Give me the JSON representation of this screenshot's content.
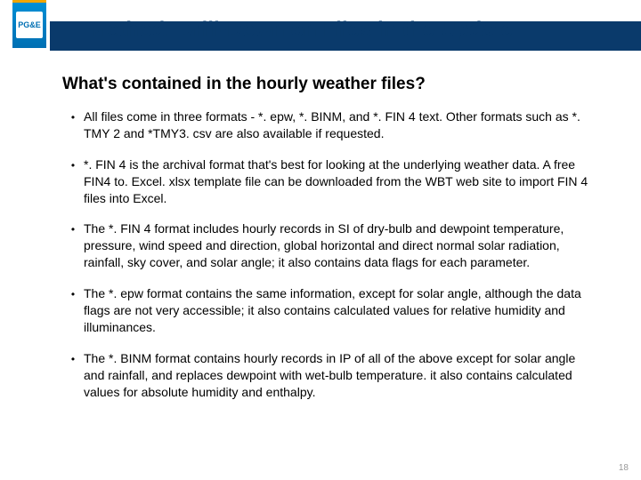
{
  "logo_text": "PG&E",
  "title": "Method: Drill-Down on Files in the Update",
  "subtitle": "What's contained in the hourly weather files?",
  "bullets": [
    "All files come in three formats - *. epw,  *. BINM, and *. FIN 4 text.  Other formats such as *. TMY 2 and *TMY3. csv are also available if requested.",
    "*. FIN 4 is the archival format that's best for looking at the underlying weather data. A free FIN4 to. Excel. xlsx template file can be downloaded from the WBT web site to import FIN 4 files into Excel.",
    "The *. FIN 4 format includes hourly records in SI of dry-bulb and dewpoint temperature, pressure, wind speed and direction, global horizontal and direct normal solar radiation, rainfall, sky cover, and solar angle; it also contains data flags for each parameter.",
    "The *. epw format contains the same information, except for solar angle, although the data flags are not very accessible; it also contains calculated values for relative humidity and illuminances.",
    "The *. BINM format contains hourly records in IP of all of the above except for solar angle and rainfall, and replaces dewpoint with wet-bulb temperature. it also contains calculated values for absolute humidity and enthalpy."
  ],
  "page_number": "18"
}
